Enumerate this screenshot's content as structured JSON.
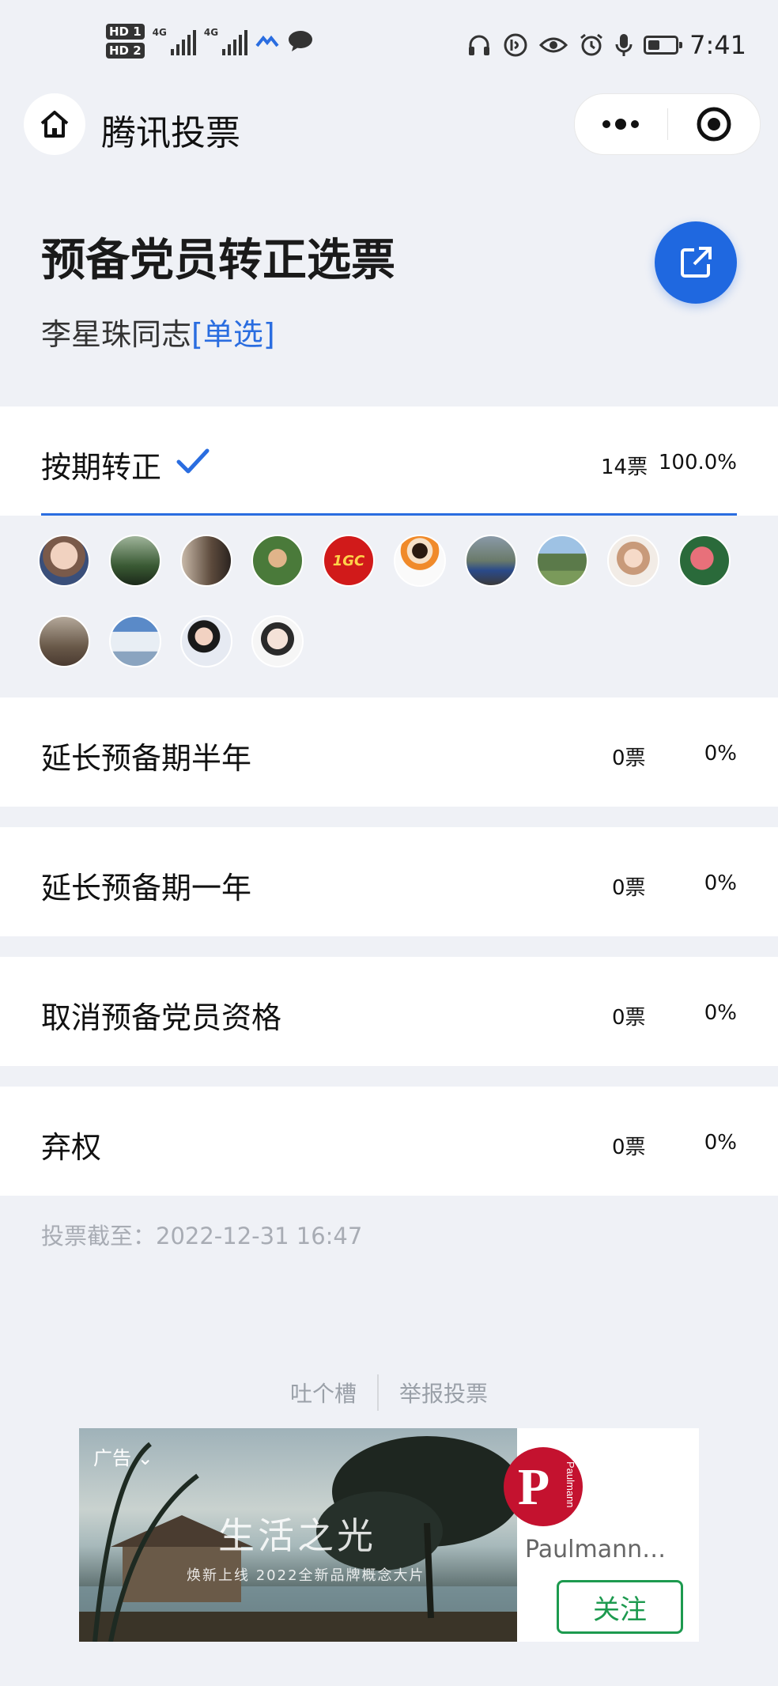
{
  "status_bar": {
    "hd1": "HD 1",
    "hd2": "HD 2",
    "net1": "4G",
    "net2": "4G",
    "time": "7:41",
    "battery_level": 0.45
  },
  "title_bar": {
    "title": "腾讯投票",
    "home_icon": "home-icon",
    "more_icon": "more-dots-icon",
    "close_icon": "target-circle-icon"
  },
  "vote": {
    "title": "预备党员转正选票",
    "subject": "李星珠同志",
    "mode_tag": "[单选]",
    "share_icon": "share-external-icon",
    "accent": "#2a6de0"
  },
  "options": [
    {
      "label": "按期转正",
      "count": "14票",
      "percent": "100.0%",
      "selected": true
    },
    {
      "label": "延长预备期半年",
      "count": "0票",
      "percent": "0%",
      "selected": false
    },
    {
      "label": "延长预备期一年",
      "count": "0票",
      "percent": "0%",
      "selected": false
    },
    {
      "label": "取消预备党员资格",
      "count": "0票",
      "percent": "0%",
      "selected": false
    },
    {
      "label": "弃权",
      "count": "0票",
      "percent": "0%",
      "selected": false
    }
  ],
  "voters": {
    "count": 14,
    "badge_text": "1GC"
  },
  "deadline": "投票截至：2022-12-31 16:47",
  "links": {
    "feedback": "吐个槽",
    "report": "举报投票"
  },
  "ad": {
    "tag": "广告",
    "headline": "生活之光",
    "subline": "焕新上线  2022全新品牌概念大片",
    "brand_name": "Paulmann柏...",
    "logo_letter": "P",
    "logo_text": "Paulmann",
    "follow_label": "关注",
    "follow_color": "#1d9a4f",
    "logo_color": "#c4122f"
  }
}
